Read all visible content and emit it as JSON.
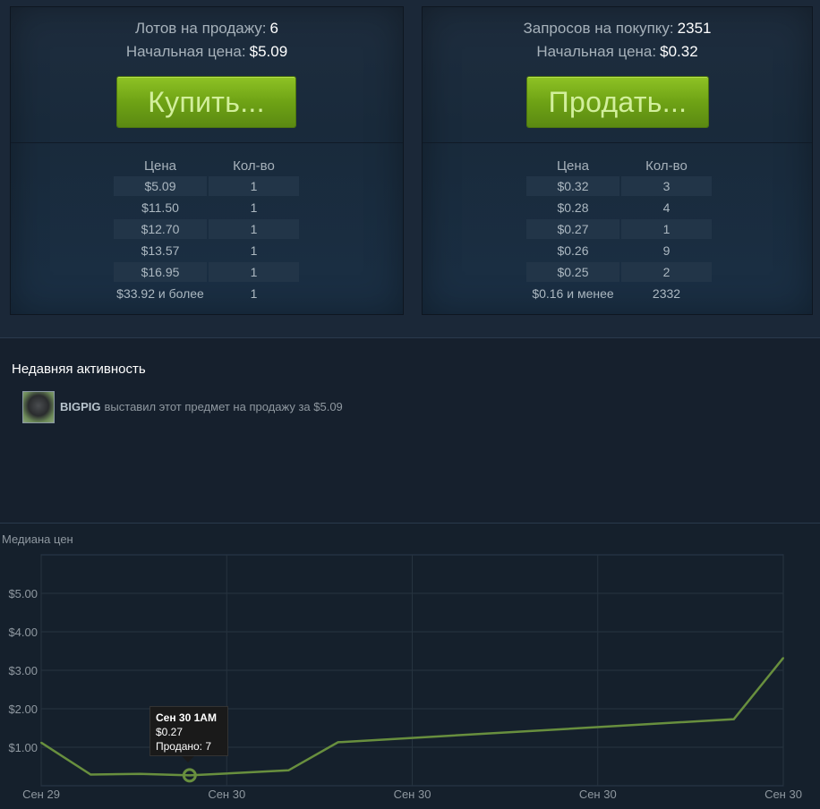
{
  "sell_panel": {
    "lots_label": "Лотов на продажу:",
    "lots_value": "6",
    "start_price_label": "Начальная цена:",
    "start_price_value": "$5.09",
    "buy_button": "Купить...",
    "col_price": "Цена",
    "col_qty": "Кол-во",
    "rows": [
      {
        "price": "$5.09",
        "qty": "1"
      },
      {
        "price": "$11.50",
        "qty": "1"
      },
      {
        "price": "$12.70",
        "qty": "1"
      },
      {
        "price": "$13.57",
        "qty": "1"
      },
      {
        "price": "$16.95",
        "qty": "1"
      },
      {
        "price": "$33.92 и более",
        "qty": "1"
      }
    ]
  },
  "buy_panel": {
    "requests_label": "Запросов на покупку:",
    "requests_value": "2351",
    "start_price_label": "Начальная цена:",
    "start_price_value": "$0.32",
    "sell_button": "Продать...",
    "col_price": "Цена",
    "col_qty": "Кол-во",
    "rows": [
      {
        "price": "$0.32",
        "qty": "3"
      },
      {
        "price": "$0.28",
        "qty": "4"
      },
      {
        "price": "$0.27",
        "qty": "1"
      },
      {
        "price": "$0.26",
        "qty": "9"
      },
      {
        "price": "$0.25",
        "qty": "2"
      },
      {
        "price": "$0.16 и менее",
        "qty": "2332"
      }
    ]
  },
  "recent_activity": {
    "title": "Недавняя активность",
    "items": [
      {
        "user": "BIGPIG",
        "text": "выставил этот предмет на продажу за $5.09"
      }
    ]
  },
  "chart_data": {
    "type": "line",
    "title": "Медиана цен",
    "xlabel": "",
    "ylabel": "",
    "x_ticks": [
      "Сен 29",
      "Сен 30",
      "Сен 30",
      "Сен 30",
      "Сен 30"
    ],
    "y_ticks": [
      "$5.00",
      "$4.00",
      "$3.00",
      "$2.00",
      "$1.00"
    ],
    "ylim": [
      0,
      6.0
    ],
    "x_range_hours": [
      0,
      48
    ],
    "series": [
      {
        "color": "#688f3e",
        "points": [
          {
            "x": 0,
            "y": 1.12
          },
          {
            "x": 3.2,
            "y": 0.29
          },
          {
            "x": 6.4,
            "y": 0.31
          },
          {
            "x": 9.6,
            "y": 0.27
          },
          {
            "x": 16,
            "y": 0.4
          },
          {
            "x": 19.2,
            "y": 1.13
          },
          {
            "x": 44.8,
            "y": 1.73
          },
          {
            "x": 48,
            "y": 3.32
          }
        ]
      }
    ],
    "highlight_index": 3,
    "tooltip": {
      "date": "Сен 30 1AM",
      "price": "$0.27",
      "sold": "Продано: 7"
    },
    "grid": true
  }
}
